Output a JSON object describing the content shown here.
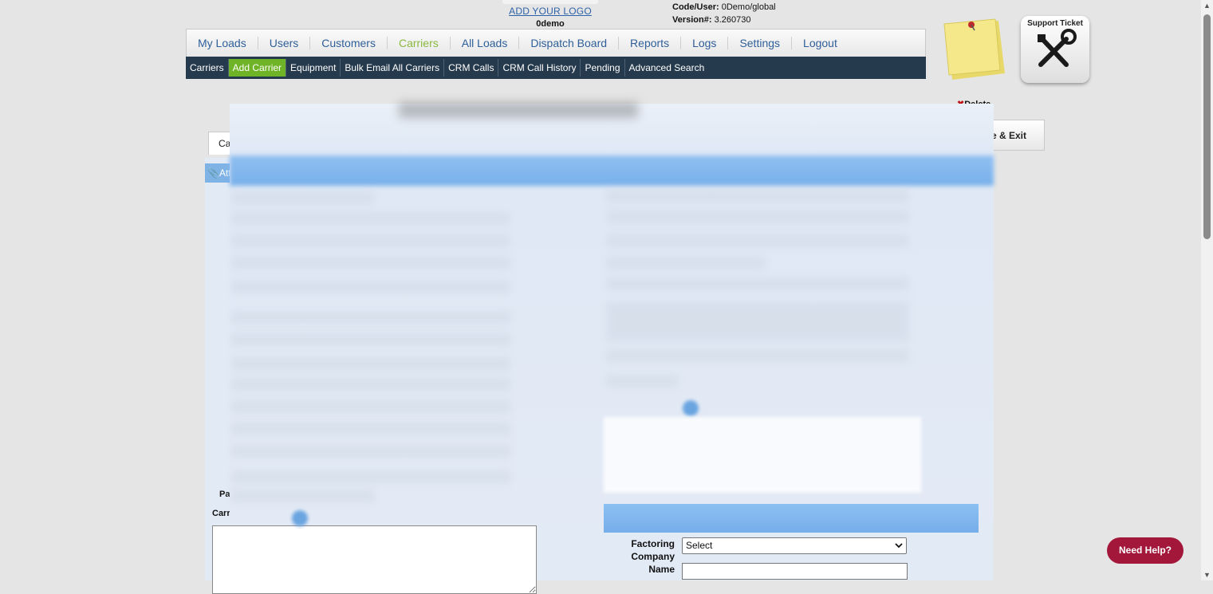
{
  "branding": {
    "logo_link": "ADD YOUR LOGO",
    "company_code": "0demo"
  },
  "account": {
    "code_user_label": "Code/User:",
    "code_user_value": "0Demo/global",
    "version_label": "Version#:",
    "version_value": "3.260730"
  },
  "main_nav": [
    {
      "label": "My Loads"
    },
    {
      "label": "Users"
    },
    {
      "label": "Customers"
    },
    {
      "label": "Carriers",
      "active": true
    },
    {
      "label": "All Loads"
    },
    {
      "label": "Dispatch Board"
    },
    {
      "label": "Reports"
    },
    {
      "label": "Logs"
    },
    {
      "label": "Settings"
    },
    {
      "label": "Logout"
    }
  ],
  "sub_nav": [
    {
      "label": "Carriers"
    },
    {
      "label": "Add Carrier",
      "active": true
    },
    {
      "label": "Equipment"
    },
    {
      "label": "Bulk Email All Carriers"
    },
    {
      "label": "CRM Calls"
    },
    {
      "label": "CRM Call History"
    },
    {
      "label": "Pending"
    },
    {
      "label": "Advanced Search"
    }
  ],
  "support_ticket": {
    "label": "Support Ticket"
  },
  "carrier_page": {
    "delete_label": "Delete",
    "save_exit_label": "e & Exit",
    "tab_fragment": "Ca",
    "attach_fragment": "Att",
    "pa_fragment": "Pa",
    "carr_fragment": "Carr"
  },
  "remit": {
    "factoring_label": "Factoring Company Name",
    "factoring_select_value": "Select",
    "name_value": ""
  },
  "help": {
    "label": "Need Help?"
  },
  "colors": {
    "nav_active": "#8ab940",
    "subnav_bg": "#263a4d",
    "subnav_active": "#6fb326",
    "help_bg": "#a3183a",
    "section_header": "#78b0ea"
  }
}
